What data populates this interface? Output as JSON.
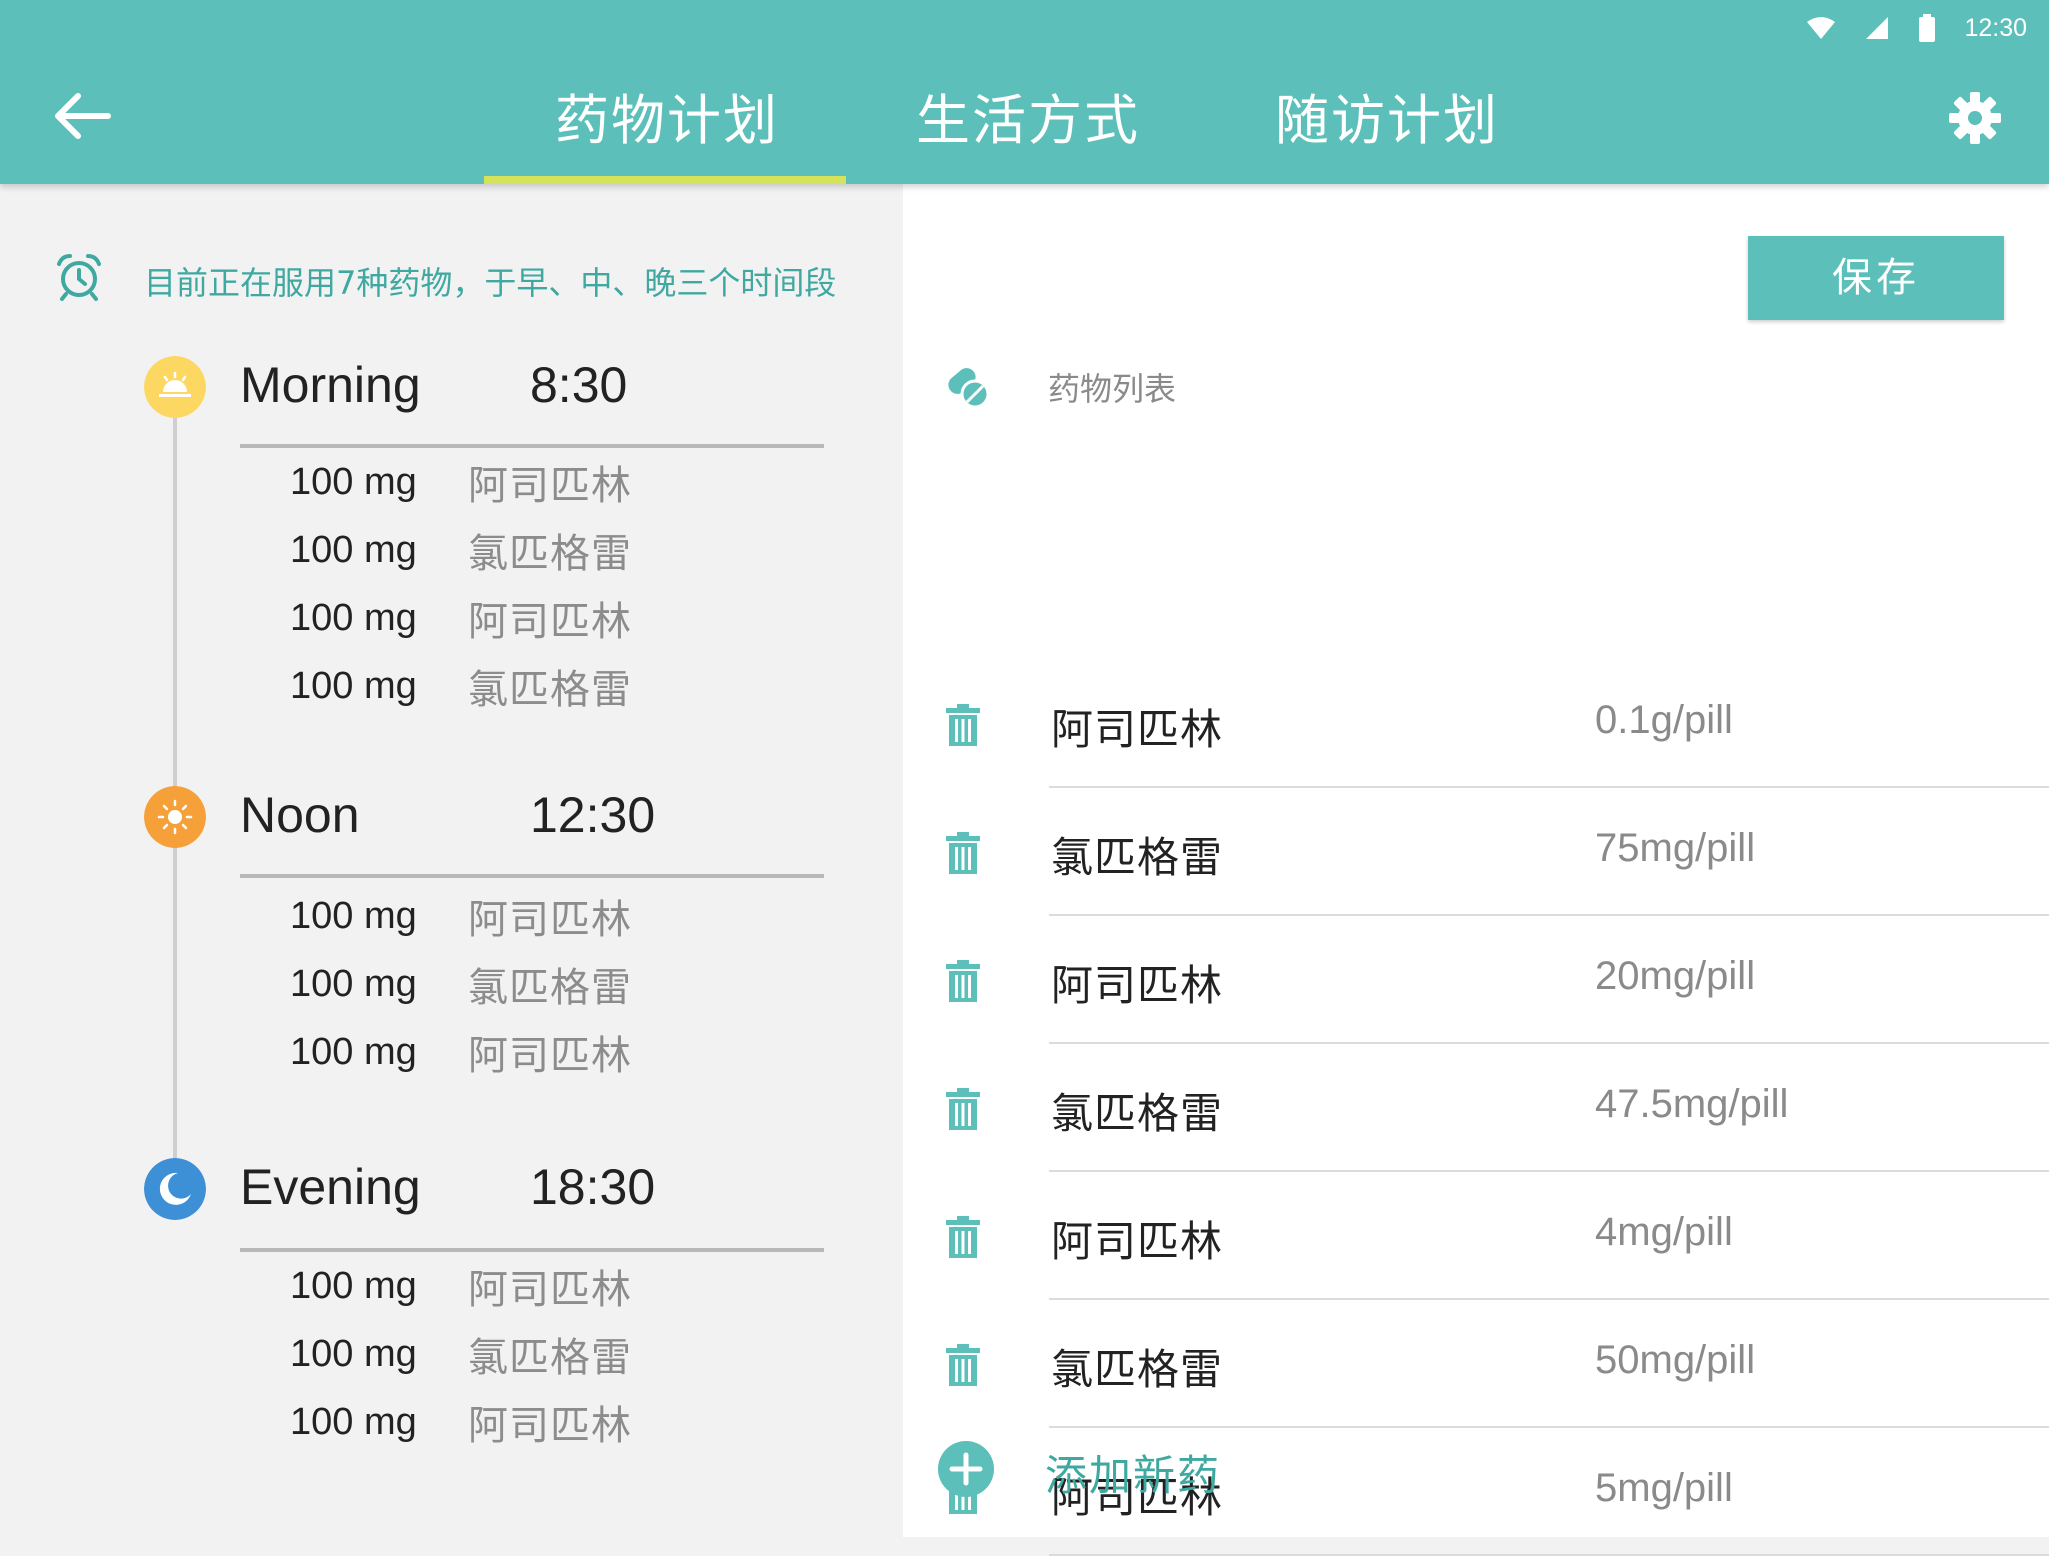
{
  "status_bar": {
    "time": "12:30"
  },
  "tabs": [
    {
      "label": "药物计划",
      "active": true
    },
    {
      "label": "生活方式",
      "active": false
    },
    {
      "label": "随访计划",
      "active": false
    }
  ],
  "colors": {
    "primary": "#5cbfb9",
    "indicator": "#d4e35a",
    "accent_text": "#3fa9a1",
    "morning": "#fcd862",
    "noon": "#f5a038",
    "evening": "#3d8fd6"
  },
  "summary": "目前正在服用7种药物，于早、中、晚三个时间段",
  "schedule": [
    {
      "name": "Morning",
      "time": "8:30",
      "doses": [
        {
          "amount": "100 mg",
          "drug": "阿司匹林"
        },
        {
          "amount": "100 mg",
          "drug": "氯匹格雷"
        },
        {
          "amount": "100 mg",
          "drug": "阿司匹林"
        },
        {
          "amount": "100 mg",
          "drug": "氯匹格雷"
        }
      ]
    },
    {
      "name": "Noon",
      "time": "12:30",
      "doses": [
        {
          "amount": "100 mg",
          "drug": "阿司匹林"
        },
        {
          "amount": "100 mg",
          "drug": "氯匹格雷"
        },
        {
          "amount": "100 mg",
          "drug": "阿司匹林"
        }
      ]
    },
    {
      "name": "Evening",
      "time": "18:30",
      "doses": [
        {
          "amount": "100 mg",
          "drug": "阿司匹林"
        },
        {
          "amount": "100 mg",
          "drug": "氯匹格雷"
        },
        {
          "amount": "100 mg",
          "drug": "阿司匹林"
        }
      ]
    }
  ],
  "right": {
    "save_label": "保存",
    "list_title": "药物列表",
    "medicines": [
      {
        "name": "阿司匹林",
        "dose": "0.1g/pill"
      },
      {
        "name": "氯匹格雷",
        "dose": "75mg/pill"
      },
      {
        "name": "阿司匹林",
        "dose": "20mg/pill"
      },
      {
        "name": "氯匹格雷",
        "dose": "47.5mg/pill"
      },
      {
        "name": "阿司匹林",
        "dose": "4mg/pill"
      },
      {
        "name": "氯匹格雷",
        "dose": "50mg/pill"
      },
      {
        "name": "阿司匹林",
        "dose": "5mg/pill"
      }
    ],
    "add_label": "添加新药"
  }
}
